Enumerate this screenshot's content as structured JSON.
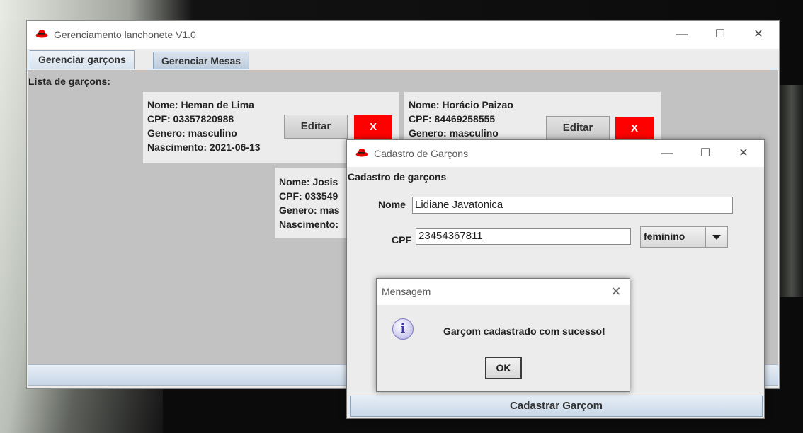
{
  "main_window": {
    "title": "Gerenciamento lanchonete V1.0",
    "controls": {
      "minimize": "—",
      "maximize": "☐",
      "close": "✕"
    },
    "tabs": [
      {
        "label": "Gerenciar garçons",
        "active": true
      },
      {
        "label": "Gerenciar Mesas",
        "active": false
      }
    ],
    "list_title": "Lista de garçons:",
    "waiters": [
      {
        "nome": "Nome: Heman de Lima",
        "cpf": "CPF: 03357820988",
        "genero": "Genero: masculino",
        "nascimento": "Nascimento: 2021-06-13",
        "edit_label": "Editar",
        "delete_label": "X"
      },
      {
        "nome": "Nome: Horácio Paizao",
        "cpf": "CPF: 84469258555",
        "genero": "Genero: masculino",
        "edit_label": "Editar",
        "delete_label": "X"
      },
      {
        "nome": "Nome: Josis",
        "cpf": "CPF: 033549",
        "genero": "Genero: mas",
        "nascimento": "Nascimento:"
      }
    ]
  },
  "cadastro_dialog": {
    "title": "Cadastro de Garçons",
    "controls": {
      "minimize": "—",
      "maximize": "☐",
      "close": "✕"
    },
    "heading": "Cadastro de garçons",
    "nome_label": "Nome",
    "nome_value": "Lidiane Javatonica",
    "cpf_label": "CPF",
    "cpf_value": "23454367811",
    "genero_selected": "feminino",
    "submit_label": "Cadastrar Garçom"
  },
  "message_dialog": {
    "title": "Mensagem",
    "close": "✕",
    "icon": "info-icon",
    "icon_glyph": "i",
    "text": "Garçom cadastrado com sucesso!",
    "ok_label": "OK"
  },
  "colors": {
    "delete_button": "#ff0000",
    "content_bg": "#c2c2c2"
  }
}
